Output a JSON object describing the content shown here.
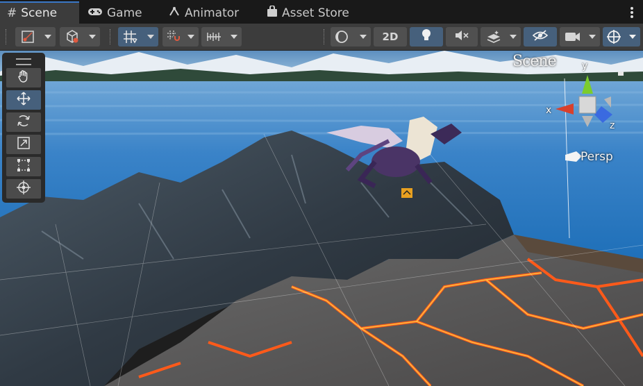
{
  "tabs": [
    {
      "label": "Scene",
      "icon": "hash-icon",
      "active": true
    },
    {
      "label": "Game",
      "icon": "gamepad-icon",
      "active": false
    },
    {
      "label": "Animator",
      "icon": "animator-icon",
      "active": false
    },
    {
      "label": "Asset Store",
      "icon": "store-bag-icon",
      "active": false
    }
  ],
  "toolbar": {
    "mode_2d_label": "2D"
  },
  "tools": [
    {
      "name": "hand-tool",
      "icon": "hand-icon",
      "selected": false
    },
    {
      "name": "move-tool",
      "icon": "move-arrows-icon",
      "selected": true
    },
    {
      "name": "rotate-tool",
      "icon": "rotate-icon",
      "selected": false
    },
    {
      "name": "scale-tool",
      "icon": "scale-icon",
      "selected": false
    },
    {
      "name": "rect-tool",
      "icon": "rect-icon",
      "selected": false
    },
    {
      "name": "transform-tool",
      "icon": "transform-icon",
      "selected": false
    }
  ],
  "scene": {
    "overlay_title": "Scene",
    "projection_label": "Persp",
    "axis_x": "x",
    "axis_y": "y",
    "axis_z": "z"
  },
  "colors": {
    "tab_bg": "#191919",
    "toolbar_bg": "#3c3c3c",
    "button_bg": "#505050",
    "button_active": "#46607c",
    "accent_blue": "#3a78c8",
    "gizmo_x": "#d8402c",
    "gizmo_y": "#7ccc2c",
    "gizmo_z": "#3a6ae0"
  }
}
